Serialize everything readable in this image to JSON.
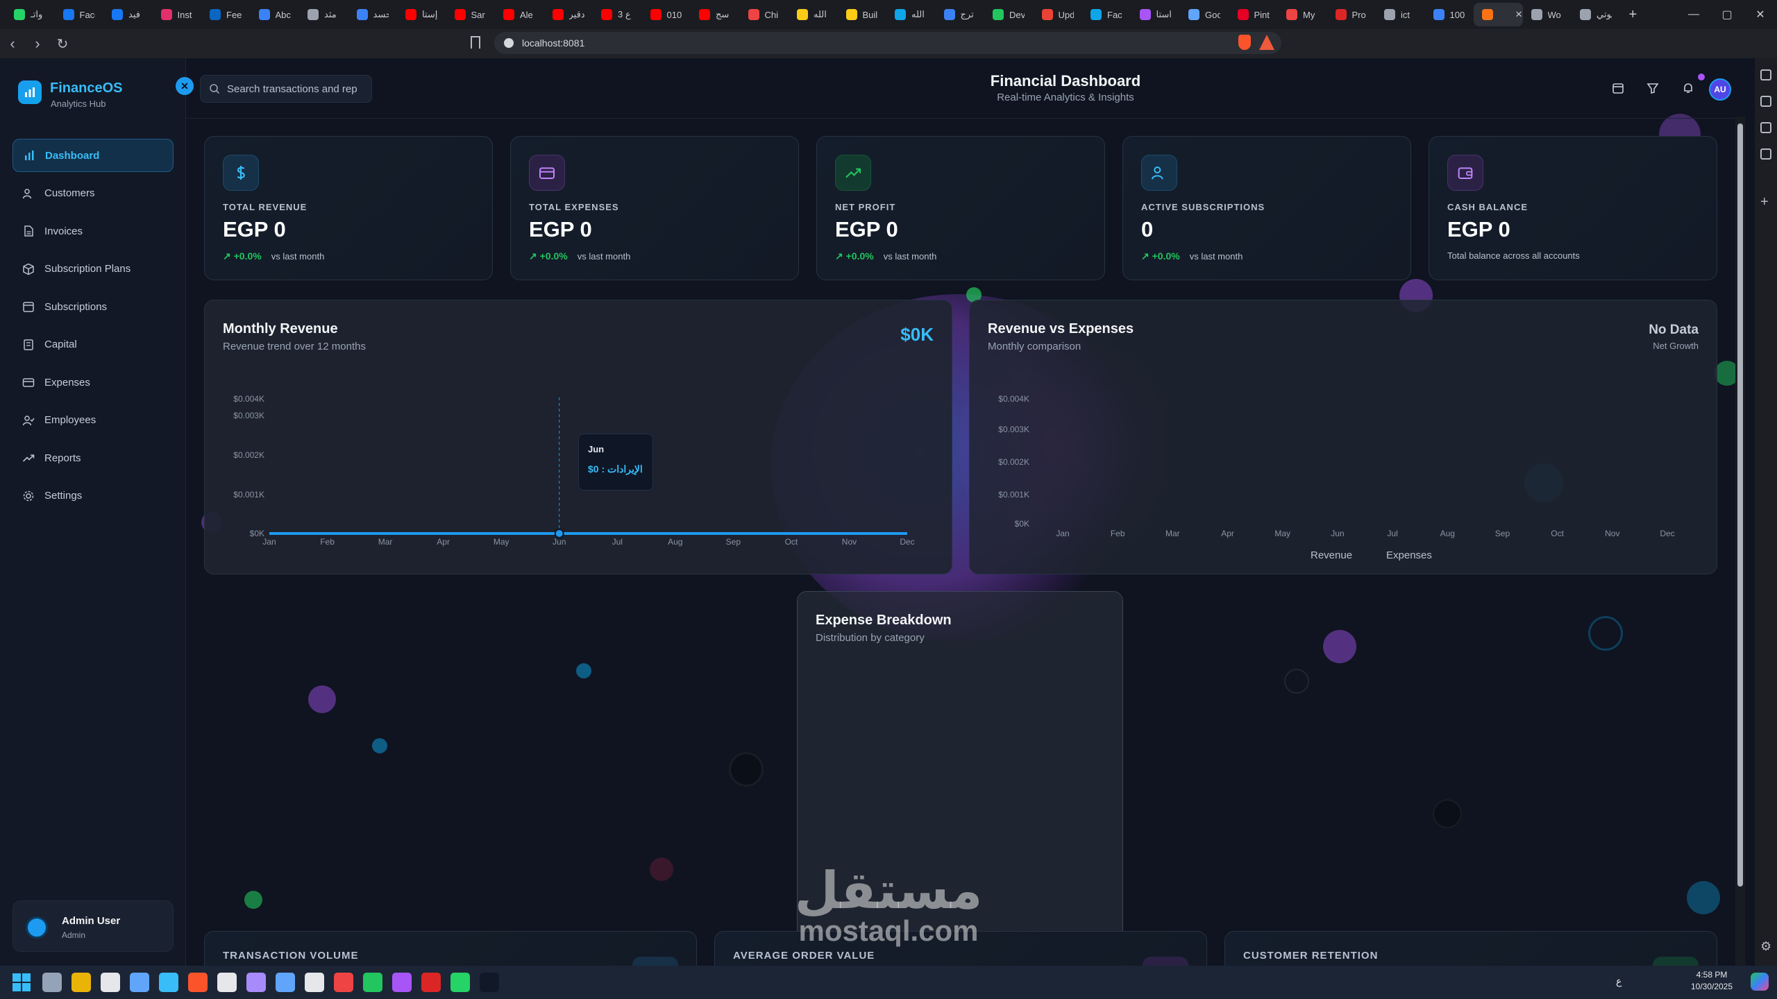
{
  "browser": {
    "tabs": [
      {
        "label": "واتـ",
        "color": "#25d366"
      },
      {
        "label": "Face",
        "color": "#1877f2"
      },
      {
        "label": "فيد",
        "color": "#1877f2"
      },
      {
        "label": "Inst",
        "color": "#e1306c"
      },
      {
        "label": "Fee",
        "color": "#0a66c2"
      },
      {
        "label": "Abc",
        "color": "#3b82f6"
      },
      {
        "label": "مثد",
        "color": "#9ca3af"
      },
      {
        "label": "حسد",
        "color": "#3b82f6"
      },
      {
        "label": "إستا",
        "color": "#ff0000"
      },
      {
        "label": "Sar",
        "color": "#ff0000"
      },
      {
        "label": "Ale",
        "color": "#ff0000"
      },
      {
        "label": "دقير",
        "color": "#ff0000"
      },
      {
        "label": "ع 3",
        "color": "#ff0000"
      },
      {
        "label": "010",
        "color": "#ff0000"
      },
      {
        "label": "سج",
        "color": "#ff0000"
      },
      {
        "label": "Chi",
        "color": "#ef4444"
      },
      {
        "label": "الله",
        "color": "#facc15"
      },
      {
        "label": "Buil",
        "color": "#facc15"
      },
      {
        "label": "الله",
        "color": "#0ea5e9"
      },
      {
        "label": "ترج",
        "color": "#3b82f6"
      },
      {
        "label": "Dev",
        "color": "#22c55e"
      },
      {
        "label": "Upd",
        "color": "#ea4335"
      },
      {
        "label": "Fac",
        "color": "#0ea5e9"
      },
      {
        "label": "استا",
        "color": "#a855f7"
      },
      {
        "label": "Goo",
        "color": "#60a5fa"
      },
      {
        "label": "Pint",
        "color": "#e60023"
      },
      {
        "label": "My",
        "color": "#ef4444"
      },
      {
        "label": "Pro",
        "color": "#dc2626"
      },
      {
        "label": "ict",
        "color": "#9ca3af"
      },
      {
        "label": "100",
        "color": "#3b82f6"
      },
      {
        "label": "",
        "color": "#f97316",
        "active": true
      },
      {
        "label": "Wo",
        "color": "#9ca3af"
      },
      {
        "label": "يوتي",
        "color": "#9ca3af"
      }
    ],
    "url": "localhost:8081"
  },
  "sidebar": {
    "brand": "FinanceOS",
    "tagline": "Analytics Hub",
    "items": [
      {
        "label": "Dashboard",
        "icon": "bar-chart-icon",
        "active": true
      },
      {
        "label": "Customers",
        "icon": "users-icon"
      },
      {
        "label": "Invoices",
        "icon": "file-text-icon"
      },
      {
        "label": "Subscription Plans",
        "icon": "package-icon"
      },
      {
        "label": "Subscriptions",
        "icon": "calendar-icon"
      },
      {
        "label": "Capital",
        "icon": "building-icon"
      },
      {
        "label": "Expenses",
        "icon": "credit-card-icon"
      },
      {
        "label": "Employees",
        "icon": "user-check-icon"
      },
      {
        "label": "Reports",
        "icon": "trending-up-icon"
      },
      {
        "label": "Settings",
        "icon": "gear-icon"
      }
    ],
    "user": {
      "name": "Admin User",
      "role": "Admin"
    }
  },
  "header": {
    "search_placeholder": "Search transactions and rep",
    "title": "Financial Dashboard",
    "subtitle": "Real-time Analytics & Insights",
    "avatar": "AU"
  },
  "stats": [
    {
      "label": "TOTAL REVENUE",
      "value": "EGP 0",
      "change": "↗ +0.0%",
      "note": "vs last month",
      "icon": "dollar-icon",
      "color": "#38bdf8",
      "bg": "#163047"
    },
    {
      "label": "TOTAL EXPENSES",
      "value": "EGP 0",
      "change": "↗ +0.0%",
      "note": "vs last month",
      "icon": "credit-card-icon",
      "color": "#c084fc",
      "bg": "#2b2145"
    },
    {
      "label": "NET PROFIT",
      "value": "EGP 0",
      "change": "↗ +0.0%",
      "note": "vs last month",
      "icon": "trending-up-icon",
      "color": "#22c55e",
      "bg": "#133a2e"
    },
    {
      "label": "ACTIVE SUBSCRIPTIONS",
      "value": "0",
      "change": "↗ +0.0%",
      "note": "vs last month",
      "icon": "users-icon",
      "color": "#38bdf8",
      "bg": "#163047"
    },
    {
      "label": "CASH BALANCE",
      "value": "EGP 0",
      "change": "",
      "note": "Total balance across all accounts",
      "icon": "wallet-icon",
      "color": "#c084fc",
      "bg": "#2b2145"
    }
  ],
  "monthly": {
    "title": "Monthly Revenue",
    "subtitle": "Revenue trend over 12 months",
    "total": "$0K",
    "tooltip": {
      "month": "Jun",
      "text": "الإيرادات : 0$"
    }
  },
  "rve": {
    "title": "Revenue vs Expenses",
    "subtitle": "Monthly comparison",
    "status": "No Data",
    "status_sub": "Net Growth"
  },
  "expense_breakdown": {
    "title": "Expense Breakdown",
    "subtitle": "Distribution by category"
  },
  "bottom_cards": [
    "TRANSACTION VOLUME",
    "AVERAGE ORDER VALUE",
    "CUSTOMER RETENTION"
  ],
  "watermark": {
    "arabic": "مستقل",
    "latin": "mostaql.com"
  },
  "taskbar": {
    "time": "4:58 PM",
    "date": "10/30/2025",
    "lang": "ع"
  },
  "chart_data": [
    {
      "type": "line",
      "title": "Monthly Revenue",
      "categories": [
        "Jan",
        "Feb",
        "Mar",
        "Apr",
        "May",
        "Jun",
        "Jul",
        "Aug",
        "Sep",
        "Oct",
        "Nov",
        "Dec"
      ],
      "series": [
        {
          "name": "الإيرادات",
          "values": [
            0,
            0,
            0,
            0,
            0,
            0,
            0,
            0,
            0,
            0,
            0,
            0
          ]
        }
      ],
      "yticks": [
        "$0K",
        "$0.001K",
        "$0.002K",
        "$0.003K",
        "$0.004K"
      ],
      "ylim": [
        0,
        0.004
      ]
    },
    {
      "type": "bar",
      "title": "Revenue vs Expenses",
      "categories": [
        "Jan",
        "Feb",
        "Mar",
        "Apr",
        "May",
        "Jun",
        "Jul",
        "Aug",
        "Sep",
        "Oct",
        "Nov",
        "Dec"
      ],
      "series": [
        {
          "name": "Revenue",
          "values": [
            0,
            0,
            0,
            0,
            0,
            0,
            0,
            0,
            0,
            0,
            0,
            0
          ]
        },
        {
          "name": "Expenses",
          "values": [
            0,
            0,
            0,
            0,
            0,
            0,
            0,
            0,
            0,
            0,
            0,
            0
          ]
        }
      ],
      "yticks": [
        "$0K",
        "$0.001K",
        "$0.002K",
        "$0.003K",
        "$0.004K"
      ],
      "ylim": [
        0,
        0.004
      ]
    }
  ]
}
